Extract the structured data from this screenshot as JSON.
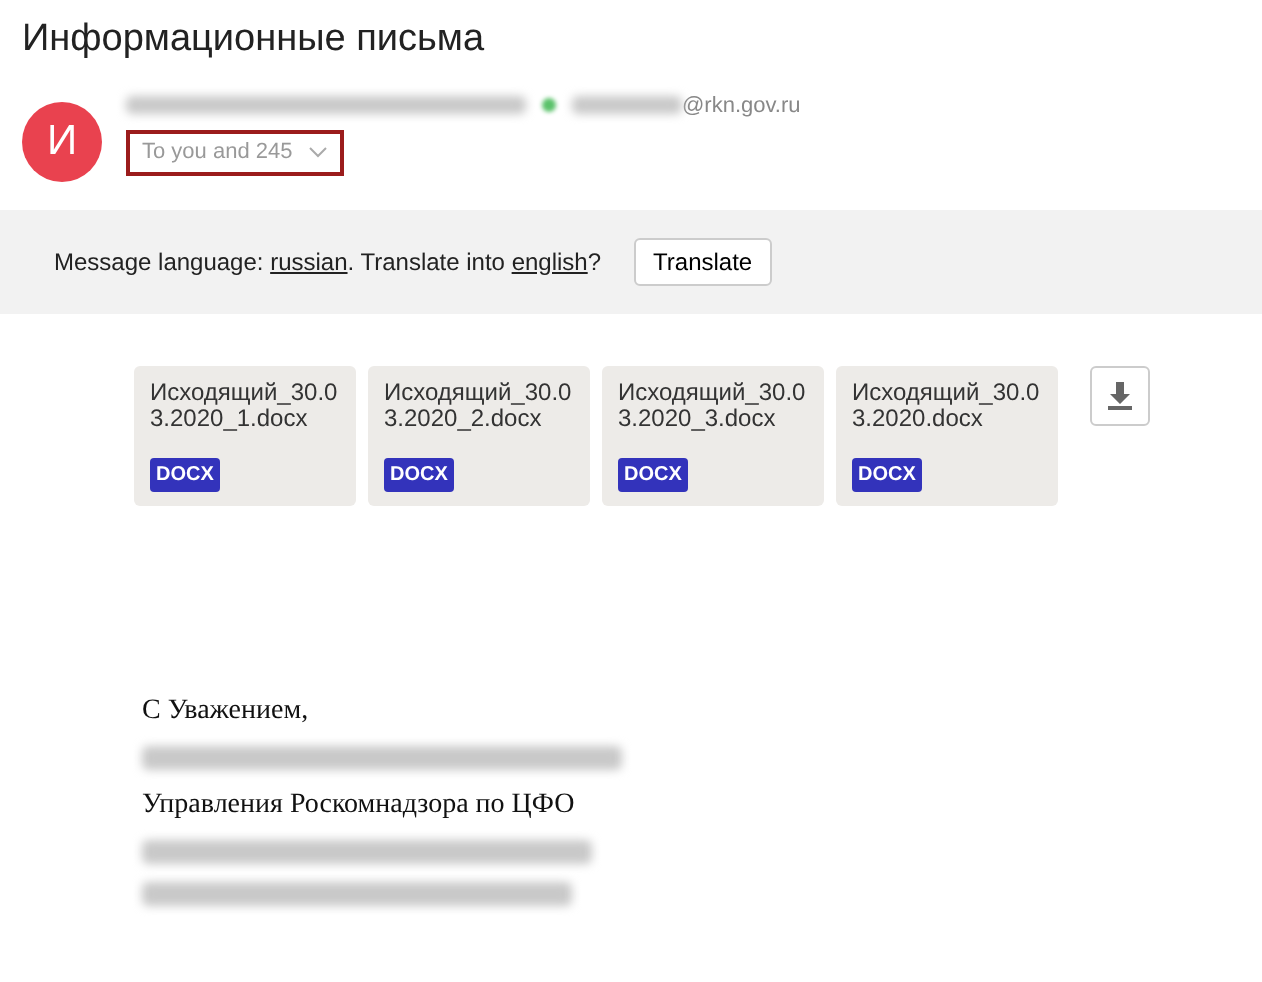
{
  "title": "Информационные письма",
  "sender": {
    "avatar_letter": "И",
    "email_domain": "@rkn.gov.ru",
    "recipients": "To you and 245",
    "recipients_highlighted": true
  },
  "translate_bar": {
    "prefix": "Message language:",
    "language": "russian",
    "middle": ". Translate into",
    "target": "english",
    "suffix": "?",
    "button": "Translate"
  },
  "attachments": [
    {
      "name": "Исходящий_30.03.2020_1.docx",
      "type": "DOCX"
    },
    {
      "name": "Исходящий_30.03.2020_2.docx",
      "type": "DOCX"
    },
    {
      "name": "Исходящий_30.03.2020_3.docx",
      "type": "DOCX"
    },
    {
      "name": "Исходящий_30.03.2020.docx",
      "type": "DOCX"
    }
  ],
  "signature": [
    {
      "kind": "text",
      "text": "С Уважением,"
    },
    {
      "kind": "blurred"
    },
    {
      "kind": "text",
      "text": "Управления Роскомнадзора по ЦФО"
    },
    {
      "kind": "blurred"
    },
    {
      "kind": "blurred"
    }
  ]
}
